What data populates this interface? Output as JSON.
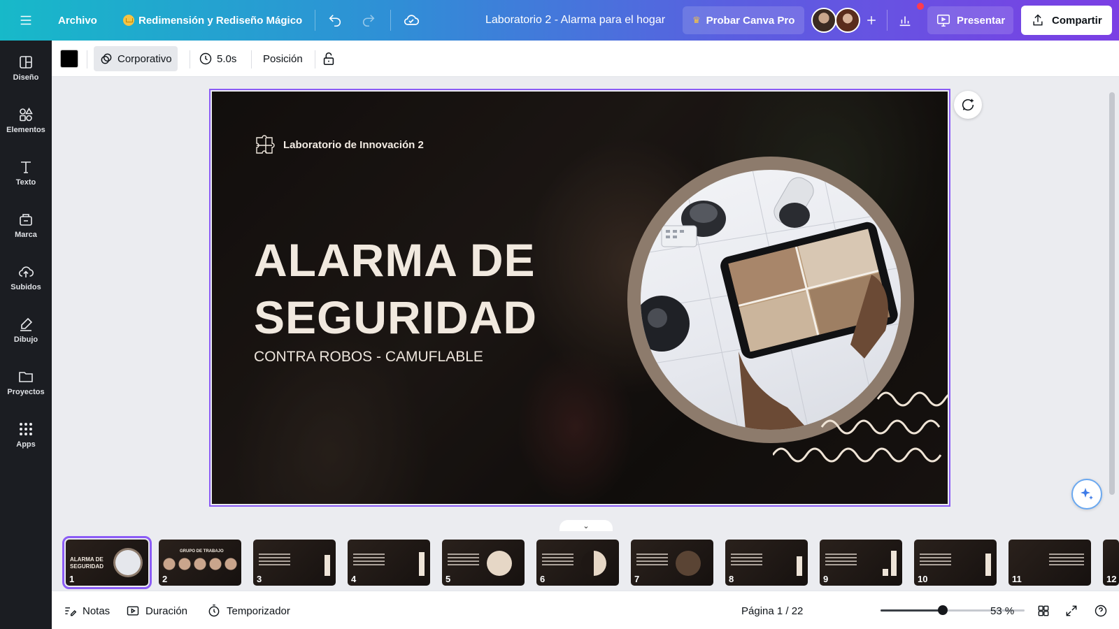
{
  "topbar": {
    "menu_icon": "hamburger-menu-icon",
    "file_label": "Archivo",
    "resize_label": "Redimensión y Rediseño Mágico",
    "doc_title": "Laboratorio 2 - Alarma para el hogar",
    "pro_label": "Probar Canva Pro",
    "present_label": "Presentar",
    "share_label": "Compartir",
    "gradient_colors": [
      "#17b9c9",
      "#2f8fd6",
      "#5a5fe0",
      "#7b3fe4"
    ]
  },
  "sidebar": {
    "items": [
      {
        "label": "Diseño",
        "icon": "layout-icon"
      },
      {
        "label": "Elementos",
        "icon": "shapes-icon"
      },
      {
        "label": "Texto",
        "icon": "text-icon"
      },
      {
        "label": "Marca",
        "icon": "brand-icon"
      },
      {
        "label": "Subidos",
        "icon": "upload-cloud-icon"
      },
      {
        "label": "Dibujo",
        "icon": "pen-icon"
      },
      {
        "label": "Proyectos",
        "icon": "folder-icon"
      },
      {
        "label": "Apps",
        "icon": "apps-grid-icon"
      }
    ]
  },
  "toolbar": {
    "color_swatch": "#000000",
    "style_label": "Corporativo",
    "duration_label": "5.0s",
    "position_label": "Posición"
  },
  "slide": {
    "logo_text": "Laboratorio de Innovación 2",
    "title_line1": "ALARMA DE",
    "title_line2": "SEGURIDAD",
    "subtitle": "CONTRA ROBOS - CAMUFLABLE",
    "ring_color": "#8d7b6c",
    "text_color": "#f1e9df"
  },
  "filmstrip": {
    "thumbs": [
      {
        "num": "1",
        "title": "ALARMA DE SEGURIDAD",
        "active": true
      },
      {
        "num": "2",
        "title": "GRUPO DE TRABAJO"
      },
      {
        "num": "3"
      },
      {
        "num": "4"
      },
      {
        "num": "5"
      },
      {
        "num": "6"
      },
      {
        "num": "7"
      },
      {
        "num": "8"
      },
      {
        "num": "9"
      },
      {
        "num": "10"
      },
      {
        "num": "11"
      },
      {
        "num": "12"
      }
    ]
  },
  "bottombar": {
    "notes_label": "Notas",
    "duration_label": "Duración",
    "timer_label": "Temporizador",
    "page_label": "Página 1 / 22",
    "zoom_label": "53 %",
    "zoom_fraction": 0.43
  }
}
